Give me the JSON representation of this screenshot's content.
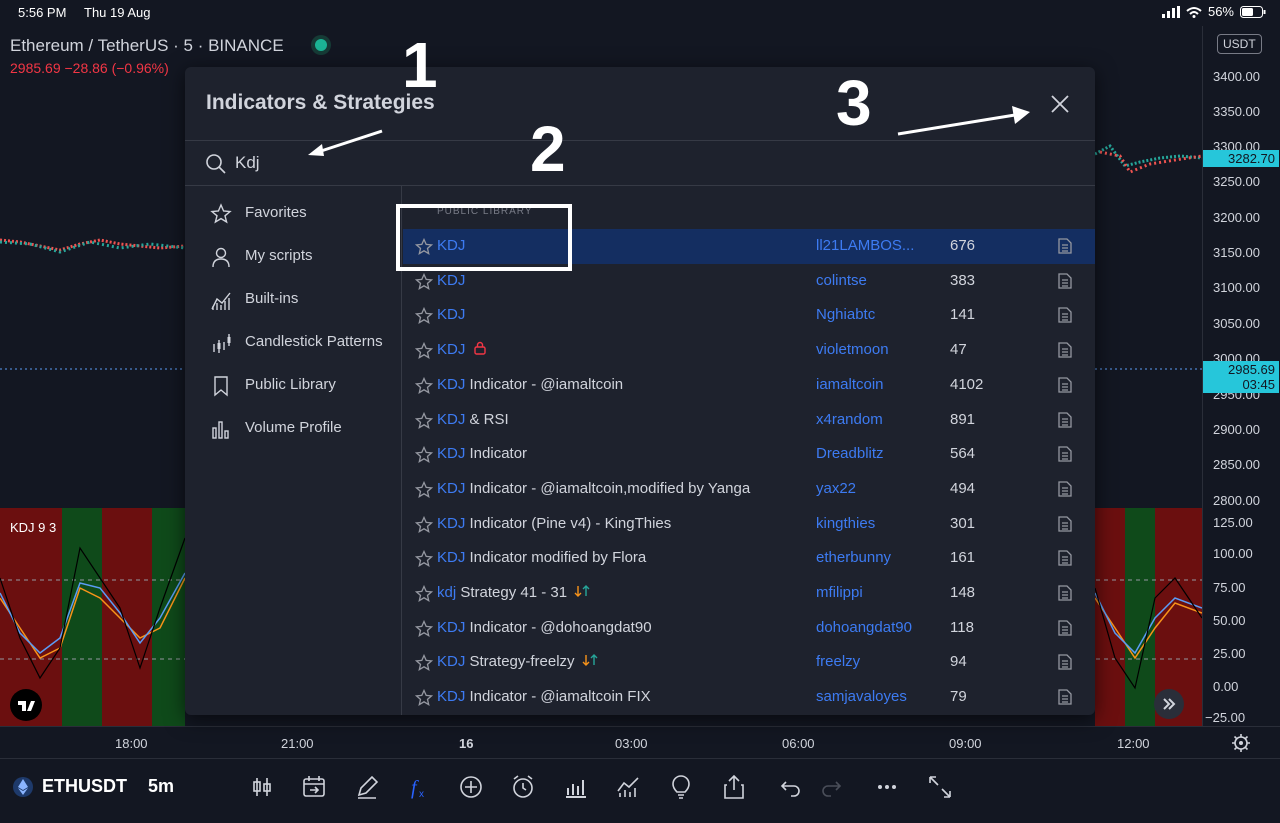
{
  "status": {
    "time": "5:56 PM",
    "date": "Thu 19 Aug",
    "battery": "56%"
  },
  "chart": {
    "title": "Ethereum / TetherUS · 5 · BINANCE",
    "change": "2985.69  −28.86 (−0.96%)",
    "indicator_label": "KDJ 9 3",
    "price_ticks": [
      "3400.00",
      "3350.00",
      "3300.00",
      "3250.00",
      "3200.00",
      "3150.00",
      "3100.00",
      "3050.00",
      "3000.00",
      "2950.00",
      "2900.00",
      "2850.00",
      "2800.00"
    ],
    "price_current": "3282.70",
    "price_last": "2985.69",
    "price_countdown": "03:45",
    "ind_ticks": [
      "125.00",
      "100.00",
      "75.00",
      "50.00",
      "25.00",
      "0.00",
      "−25.00"
    ],
    "time_ticks": [
      "18:00",
      "21:00",
      "16",
      "03:00",
      "06:00",
      "09:00",
      "12:00"
    ],
    "currency": "USDT",
    "colors": {
      "up": "#26a69a",
      "down": "#ef5350",
      "accent": "#2962ff"
    }
  },
  "toolbar": {
    "symbol": "ETHUSDT",
    "timeframe": "5m"
  },
  "modal": {
    "title": "Indicators & Strategies",
    "search_value": "Kdj",
    "sidebar": [
      {
        "label": "Favorites",
        "icon": "star-icon"
      },
      {
        "label": "My scripts",
        "icon": "user-icon"
      },
      {
        "label": "Built-ins",
        "icon": "builtins-icon"
      },
      {
        "label": "Candlestick Patterns",
        "icon": "candlestick-icon"
      },
      {
        "label": "Public Library",
        "icon": "bookmark-icon"
      },
      {
        "label": "Volume Profile",
        "icon": "volume-profile-icon"
      }
    ],
    "section": "PUBLIC LIBRARY",
    "results": [
      {
        "hl": "KDJ",
        "rest": "",
        "author": "ll21LAMBOS...",
        "count": "676",
        "selected": true
      },
      {
        "hl": "KDJ",
        "rest": "",
        "author": "colintse",
        "count": "383"
      },
      {
        "hl": "KDJ",
        "rest": "",
        "author": "Nghiabtc",
        "count": "141"
      },
      {
        "hl": "KDJ",
        "rest": "",
        "author": "violetmoon",
        "count": "47",
        "lock": true
      },
      {
        "hl": "KDJ",
        "rest": " Indicator - @iamaltcoin",
        "author": "iamaltcoin",
        "count": "4102"
      },
      {
        "hl": "KDJ",
        "rest": " & RSI",
        "author": "x4random",
        "count": "891"
      },
      {
        "hl": "KDJ",
        "rest": " Indicator",
        "author": "Dreadblitz",
        "count": "564"
      },
      {
        "hl": "KDJ",
        "rest": " Indicator - @iamaltcoin,modified by Yanga",
        "author": "yax22",
        "count": "494"
      },
      {
        "hl": "KDJ",
        "rest": " Indicator (Pine v4) - KingThies",
        "author": "kingthies",
        "count": "301"
      },
      {
        "hl": "KDJ",
        "rest": " Indicator modified by Flora",
        "author": "etherbunny",
        "count": "161"
      },
      {
        "hl": "kdj",
        "rest": " Strategy 41 - 31",
        "author": "mfilippi",
        "count": "148",
        "strategy": true
      },
      {
        "hl": "KDJ",
        "rest": " Indicator - @dohoangdat90",
        "author": "dohoangdat90",
        "count": "118"
      },
      {
        "hl": "KDJ",
        "rest": " Strategy-freelzy",
        "author": "freelzy",
        "count": "94",
        "strategy": true
      },
      {
        "hl": "KDJ",
        "rest": " Indicator - @iamaltcoin FIX",
        "author": "samjavaloyes",
        "count": "79"
      }
    ]
  },
  "annotations": [
    "1",
    "2",
    "3"
  ]
}
